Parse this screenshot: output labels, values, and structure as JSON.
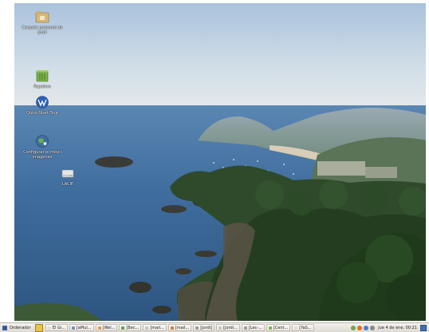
{
  "desktop": {
    "icons": [
      {
        "name": "personal-folder",
        "label": "Carpeta personal de jordi"
      },
      {
        "name": "trash",
        "label": "Papelera"
      },
      {
        "name": "quick-start-tour",
        "label": "Quick Start Tour"
      },
      {
        "name": "configure-mobile",
        "label": "Configurar el móvil imágenes"
      },
      {
        "name": "lacie-drive",
        "label": "LACIE"
      }
    ]
  },
  "taskbar": {
    "menu_label": "Ordenador",
    "tasks": [
      {
        "label": "El Gi..."
      },
      {
        "label": "[aMul..."
      },
      {
        "label": "[Wel..."
      },
      {
        "label": "[Bec..."
      },
      {
        "label": "[mail..."
      },
      {
        "label": "[mail..."
      },
      {
        "label": "[jordi]"
      },
      {
        "label": "[jordi..."
      },
      {
        "label": "[Lec-..."
      },
      {
        "label": "[Cent..."
      },
      {
        "label": "[YaS..."
      }
    ],
    "clock": "jue 4 de ene, 00:21"
  }
}
